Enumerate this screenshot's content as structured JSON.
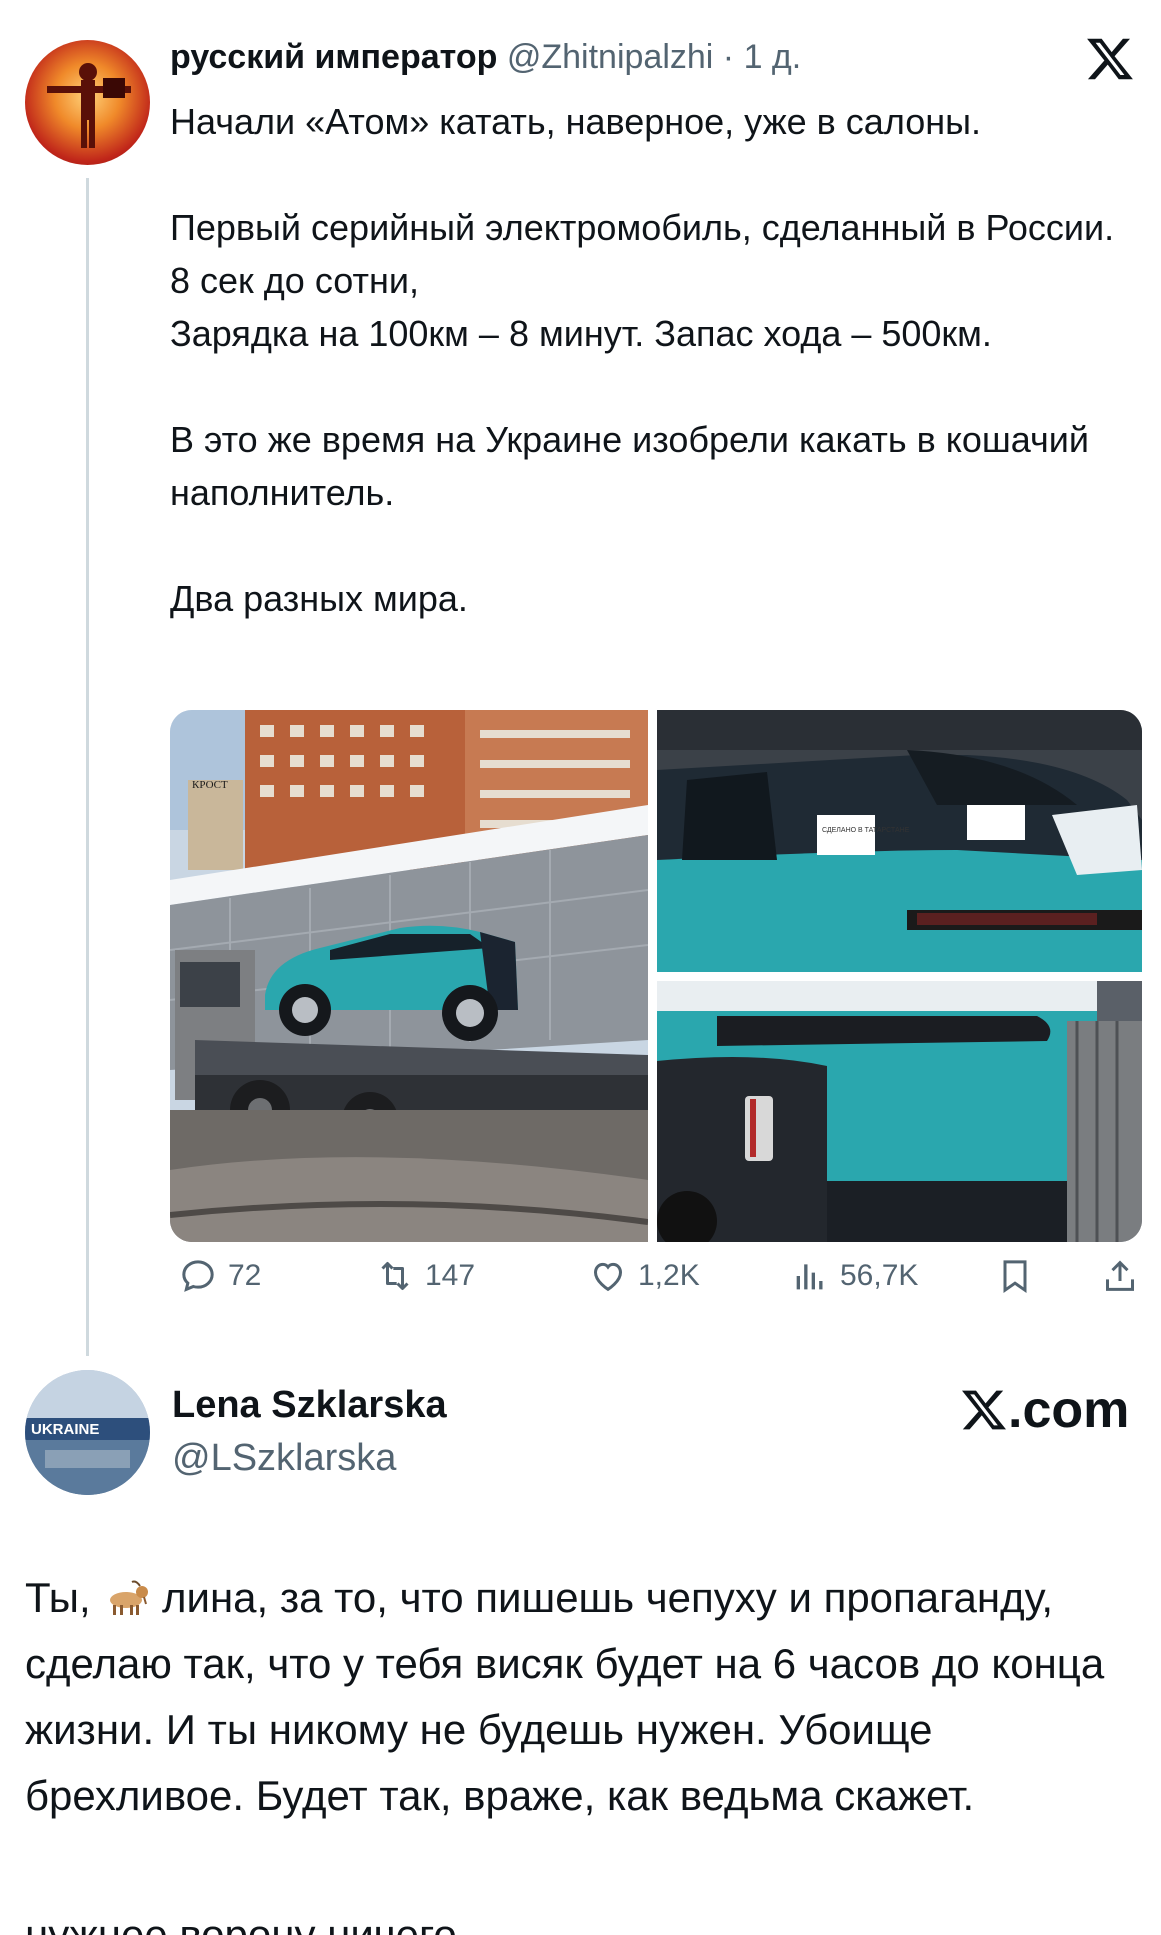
{
  "tweet": {
    "author_name": "русский император",
    "author_handle": "@Zhitnipalzhi",
    "separator": "·",
    "time": "1 д.",
    "text": "Начали «Атом» катать, наверное, уже в салоны.\n\nПервый серийный электромобиль, сделанный в России. 8 сек до сотни,\nЗарядка на 100км – 8 минут. Запас хода – 500км.\n\nВ это же время на Украине изобрели какать в кошачий наполнитель.\n\nДва разных мира.",
    "sticker_text": "СДЕЛАНО В ТАТАРСТАНЕ",
    "store_sign": "КРОСТ",
    "stats": {
      "replies": "72",
      "retweets": "147",
      "likes": "1,2K",
      "views": "56,7K"
    }
  },
  "reply": {
    "author_name": "Lena Szklarska",
    "author_handle": "@LSzklarska",
    "avatar_banner": "UKRAINE",
    "brand": ".com",
    "text_before_emoji": "Ты, ",
    "text_after_emoji": "лина, за то, что пишешь чепуху и пропаганду, сделаю так, что у тебя висяк будет на 6 часов до конца жизни. И ты никому не будешь нужен. Убоище брехливое. Будет так, враже, как ведьма скажет.",
    "cutoff_text": "нужнее ворону ничего"
  },
  "colors": {
    "text": "#0f1419",
    "secondary": "#536471",
    "thread_line": "#cfd9de",
    "car_teal": "#2aa7ae"
  }
}
